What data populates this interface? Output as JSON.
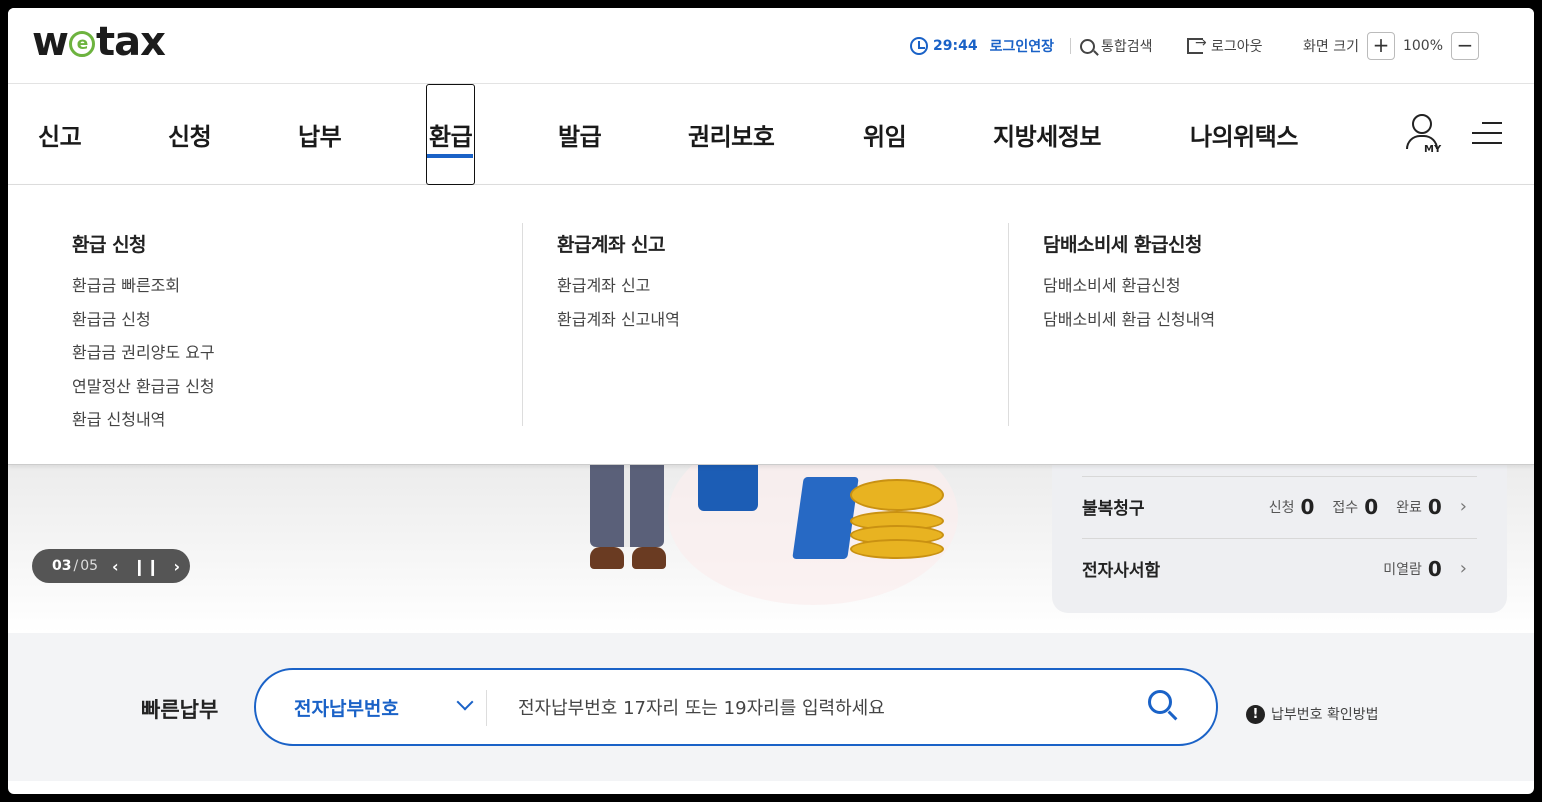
{
  "header": {
    "logo_w": "w",
    "logo_e": "e",
    "logo_rest": "tax",
    "timer": "29:44",
    "login_extend": "로그인연장",
    "search": "통합검색",
    "logout": "로그아웃",
    "zoom_label": "화면 크기",
    "zoom_plus": "+",
    "zoom_value": "100%",
    "zoom_minus": "−"
  },
  "nav": {
    "items": [
      "신고",
      "신청",
      "납부",
      "환급",
      "발급",
      "권리보호",
      "위임",
      "지방세정보",
      "나의위택스"
    ],
    "active": "환급",
    "my_label": "MY"
  },
  "mega": {
    "col1": {
      "title": "환급 신청",
      "links": [
        "환급금 빠른조회",
        "환급금 신청",
        "환급금 권리양도 요구",
        "연말정산 환급금 신청",
        "환급 신청내역"
      ]
    },
    "col2": {
      "title": "환급계좌 신고",
      "links": [
        "환급계좌 신고",
        "환급계좌 신고내역"
      ]
    },
    "col3": {
      "title": "담배소비세 환급신청",
      "links": [
        "담배소비세 환급신청",
        "담배소비세 환급 신청내역"
      ]
    }
  },
  "banner": {
    "page_current": "03",
    "page_sep": "/",
    "page_total": "05"
  },
  "status": {
    "appeal": {
      "title": "불복청구",
      "apply_label": "신청",
      "apply": "0",
      "receive_label": "접수",
      "receive": "0",
      "done_label": "완료",
      "done": "0"
    },
    "mailbox": {
      "title": "전자사서함",
      "unread_label": "미열람",
      "unread": "0"
    }
  },
  "quickpay": {
    "label": "빠른납부",
    "select": "전자납부번호",
    "placeholder": "전자납부번호 17자리 또는 19자리를 입력하세요",
    "help": "납부번호 확인방법"
  }
}
